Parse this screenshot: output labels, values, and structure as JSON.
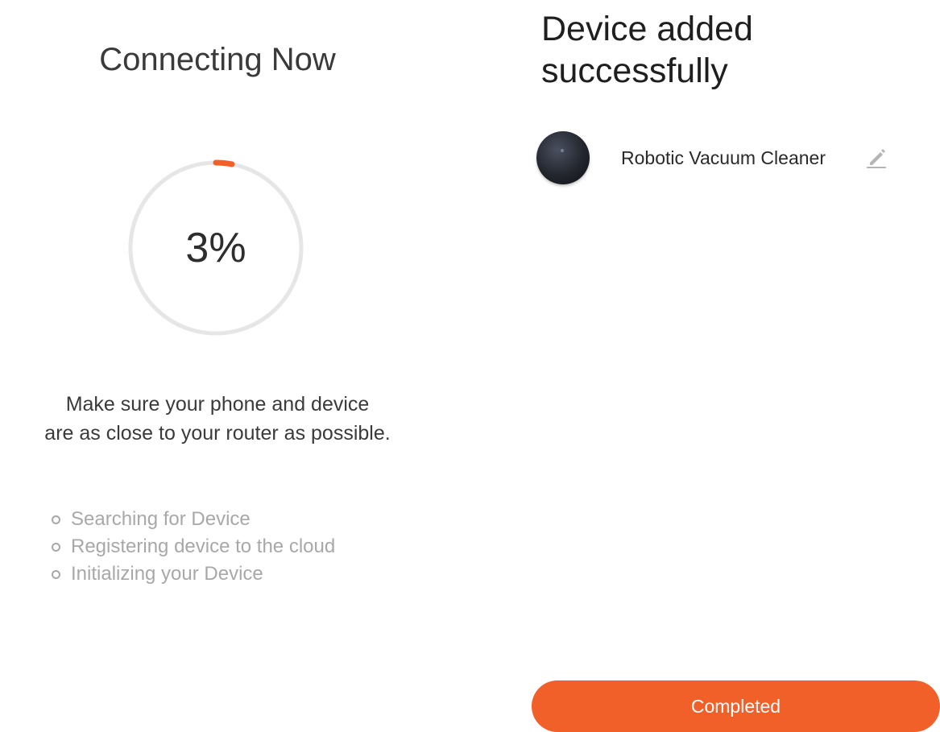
{
  "connecting": {
    "title": "Connecting Now",
    "progress_percent": 3,
    "progress_label": "3%",
    "hint_line1": "Make sure your phone and device",
    "hint_line2": "are as close to your router as possible.",
    "steps": [
      {
        "label": "Searching for Device"
      },
      {
        "label": "Registering device to the cloud"
      },
      {
        "label": "Initializing your Device"
      }
    ]
  },
  "added": {
    "title_line1": "Device added",
    "title_line2": "successfully",
    "device": {
      "name": "Robotic Vacuum Cleaner",
      "avatar_icon": "robot-vacuum-icon",
      "edit_icon": "pencil-icon"
    },
    "complete_label": "Completed"
  },
  "colors": {
    "accent": "#f2602a",
    "ring_track": "#e6e6e6",
    "step_text": "#a8a8a8"
  }
}
